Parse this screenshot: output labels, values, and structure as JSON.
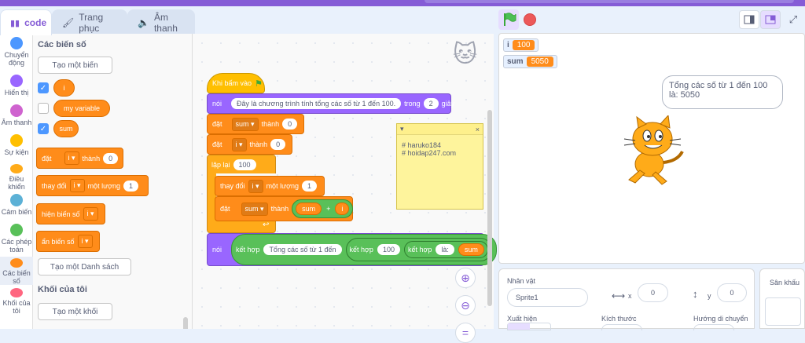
{
  "tabs": [
    {
      "label": "code",
      "icon": "code-icon"
    },
    {
      "label": "Trang phục",
      "icon": "brush-icon"
    },
    {
      "label": "Âm thanh",
      "icon": "speaker-icon"
    }
  ],
  "categories": [
    {
      "label": "Chuyển động",
      "color": "#4c97ff"
    },
    {
      "label": "Hiển thị",
      "color": "#9966ff"
    },
    {
      "label": "Âm thanh",
      "color": "#cf63cf"
    },
    {
      "label": "Sự kiện",
      "color": "#ffbf00"
    },
    {
      "label": "Điều khiển",
      "color": "#ffab19"
    },
    {
      "label": "Cảm biến",
      "color": "#5cb1d6"
    },
    {
      "label": "Các phép toán",
      "color": "#59c059"
    },
    {
      "label": "Các biến số",
      "color": "#ff8c1a"
    },
    {
      "label": "Khối của tôi",
      "color": "#ff6680"
    }
  ],
  "palette": {
    "variables_title": "Các biến số",
    "make_variable": "Tạo một biến",
    "vars": [
      {
        "name": "i",
        "checked": true
      },
      {
        "name": "my variable",
        "checked": false
      },
      {
        "name": "sum",
        "checked": true
      }
    ],
    "set_block": {
      "word": "đặt",
      "var": "i",
      "to": "thành",
      "value": "0"
    },
    "change_block": {
      "word": "thay đổi",
      "var": "i",
      "by": "một lượng",
      "value": "1"
    },
    "show_block": {
      "word": "hiện biến số",
      "var": "i"
    },
    "hide_block": {
      "word": "ẩn biến số",
      "var": "i"
    },
    "make_list": "Tạo một Danh sách",
    "myblocks_title": "Khối của tôi",
    "make_block": "Tạo một khối"
  },
  "script": {
    "hat": "Khi bấm vào",
    "say1": {
      "word": "nói",
      "text": "Đây là chương trình tính tổng các số từ 1 đến 100.",
      "for": "trong",
      "secs": "2",
      "unit": "giây"
    },
    "set_sum": {
      "word": "đặt",
      "var": "sum",
      "to": "thành",
      "value": "0"
    },
    "set_i": {
      "word": "đặt",
      "var": "i",
      "to": "thành",
      "value": "0"
    },
    "repeat": {
      "word": "lặp lại",
      "times": "100"
    },
    "change_i": {
      "word": "thay đổi",
      "var": "i",
      "by": "một lượng",
      "value": "1"
    },
    "set_sum2": {
      "word": "đặt",
      "var": "sum",
      "to": "thành",
      "a": "sum",
      "op": "+",
      "b": "i"
    },
    "say2": {
      "word": "nói",
      "join1": "kết hợp",
      "text1": "Tổng các số từ 1 đến",
      "join2": "kết hợp",
      "num": "100",
      "join3": "kết hợp",
      "text2": "là:",
      "var": "sum"
    }
  },
  "note": {
    "collapse": "▾",
    "close": "×",
    "line1": "# haruko184",
    "line2": "# hoidap247.com"
  },
  "monitors": [
    {
      "name": "i",
      "value": "100"
    },
    {
      "name": "sum",
      "value": "5050"
    }
  ],
  "bubble": {
    "line1": "Tổng các số từ 1 đến  100",
    "line2": "là: 5050"
  },
  "sprite_info": {
    "sprite_label": "Nhân vật",
    "sprite_name": "Sprite1",
    "x_label": "x",
    "x_value": "0",
    "y_label": "y",
    "y_value": "0",
    "show_label": "Xuất hiện",
    "size_label": "Kích thước",
    "direction_label": "Hướng di chuyển"
  },
  "stage_panel": {
    "label": "Sân khấu"
  },
  "colors": {
    "accent": "#855cd6",
    "variables": "#ff8c1a",
    "looks": "#9966ff",
    "events": "#ffbf00",
    "operators": "#59c059"
  }
}
